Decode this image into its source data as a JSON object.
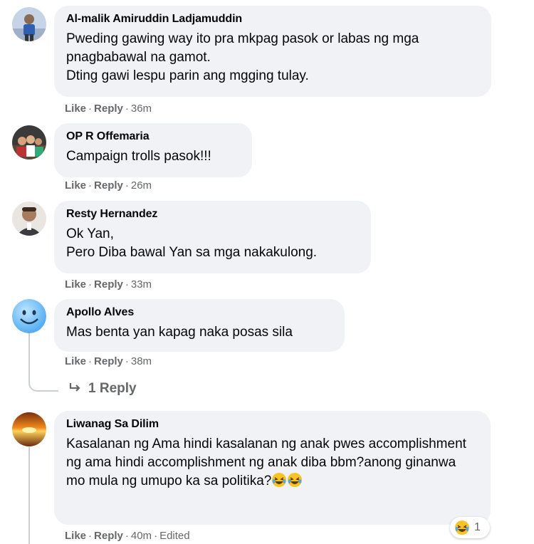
{
  "comments": [
    {
      "author": "Al-malik Amiruddin Ladjamuddin",
      "text": "Pweding gawing way ito pra mkpag pasok or labas ng mga pnagbabawal na gamot.\nDting gawi lespu parin ang mgging tulay.",
      "like": "Like",
      "reply": "Reply",
      "time": "36m",
      "avatar_icon": "person-photo-avatar"
    },
    {
      "author": "OP R Offemaria",
      "text": "Campaign trolls pasok!!!",
      "like": "Like",
      "reply": "Reply",
      "time": "26m",
      "avatar_icon": "group-photo-avatar"
    },
    {
      "author": "Resty Hernandez",
      "text": "Ok Yan,\nPero Diba bawal Yan sa mga nakakulong.",
      "like": "Like",
      "reply": "Reply",
      "time": "33m",
      "avatar_icon": "man-photo-avatar"
    },
    {
      "author": "Apollo Alves",
      "text": "Mas benta yan kapag naka posas sila",
      "like": "Like",
      "reply": "Reply",
      "time": "38m",
      "avatar_icon": "smiley-avatar",
      "replies_link": "1 Reply"
    },
    {
      "author": "Liwanag Sa Dilim",
      "text": "Kasalanan ng Ama hindi kasalanan ng anak pwes accomplishment ng ama hindi accomplishment ng anak diba bbm?anong ginanwa mo mula ng umupo ka sa politika?",
      "like": "Like",
      "reply": "Reply",
      "time": "40m",
      "edited": "Edited",
      "avatar_icon": "sunset-avatar",
      "reaction_count": "1",
      "reaction_icon": "laughing-emoji"
    }
  ],
  "separator": "·",
  "colors": {
    "bubble_bg": "#f0f2f5",
    "meta_text": "#65676b",
    "thread_line": "#ccd0d5"
  }
}
